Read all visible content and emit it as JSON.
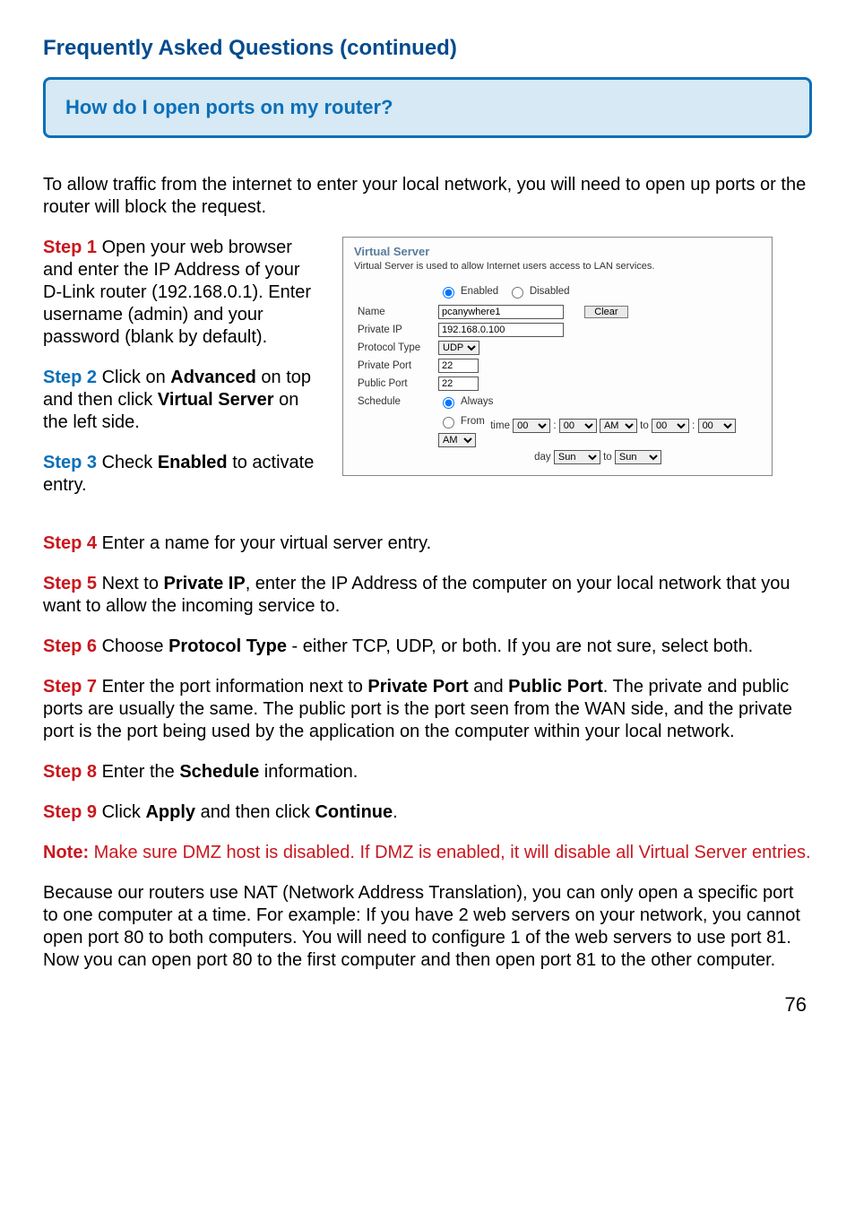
{
  "title": "Frequently Asked Questions (continued)",
  "question": "How do I open ports on my router?",
  "intro": "To allow traffic from the internet to enter your local network, you will need to open up ports or the router will block the request.",
  "steps": {
    "s1": {
      "label": "Step 1",
      "text": " Open your web browser and enter the IP Address of your D-Link router (192.168.0.1). Enter username (admin) and your password (blank by default)."
    },
    "s2": {
      "label": "Step 2",
      "text_a": " Click on ",
      "bold_a": "Advanced",
      "text_b": " on top and then click ",
      "bold_b": "Virtual Server",
      "text_c": " on the left side."
    },
    "s3": {
      "label": "Step 3",
      "text_a": " Check ",
      "bold_a": "Enabled",
      "text_b": " to activate entry."
    },
    "s4": {
      "label": "Step 4",
      "text": " Enter a name for your virtual server entry."
    },
    "s5": {
      "label": "Step 5",
      "text_a": " Next to ",
      "bold_a": "Private IP",
      "text_b": ", enter the IP Address of the computer on your local network that you want to allow the incoming service to."
    },
    "s6": {
      "label": "Step 6",
      "text_a": " Choose ",
      "bold_a": "Protocol Type",
      "text_b": " - either TCP, UDP, or both. If you are not sure, select both."
    },
    "s7": {
      "label": "Step 7",
      "text_a": " Enter the port information next to ",
      "bold_a": "Private Port",
      "text_b": " and ",
      "bold_b": "Public Port",
      "text_c": ". The private and public ports are usually the same. The public port is the port seen from the WAN side, and the private port is the port being used by the application on the computer within your local network."
    },
    "s8": {
      "label": "Step 8",
      "text_a": " Enter the ",
      "bold_a": "Schedule",
      "text_b": " information."
    },
    "s9": {
      "label": "Step 9",
      "text_a": " Click ",
      "bold_a": "Apply",
      "text_b": " and then click ",
      "bold_b": "Continue",
      "text_c": "."
    }
  },
  "note": {
    "label": "Note:",
    "text": " Make sure DMZ host is disabled. If DMZ is enabled, it will disable all Virtual Server entries."
  },
  "nat_text": "Because our routers use NAT (Network Address Translation), you can only open a specific port to one computer at a time. For example: If you have 2 web servers on your network, you cannot open port 80 to both computers. You will need to configure 1 of the web servers to use port 81. Now you can open port 80 to the first computer and then open port 81 to the other computer.",
  "panel": {
    "title": "Virtual Server",
    "desc": "Virtual Server is used to allow Internet users access to LAN services.",
    "enabled": "Enabled",
    "disabled": "Disabled",
    "labels": {
      "name": "Name",
      "private_ip": "Private IP",
      "protocol": "Protocol Type",
      "private_port": "Private Port",
      "public_port": "Public Port",
      "schedule": "Schedule"
    },
    "name_value": "pcanywhere1",
    "clear": "Clear",
    "private_ip_value": "192.168.0.100",
    "protocol_value": "UDP",
    "private_port_value": "22",
    "public_port_value": "22",
    "schedule_always": "Always",
    "schedule_from": "From",
    "time_label": "time",
    "to_label": "to",
    "day_label": "day",
    "hh": "00",
    "mm": "00",
    "ampm": "AM",
    "day": "Sun"
  },
  "page_number": "76"
}
